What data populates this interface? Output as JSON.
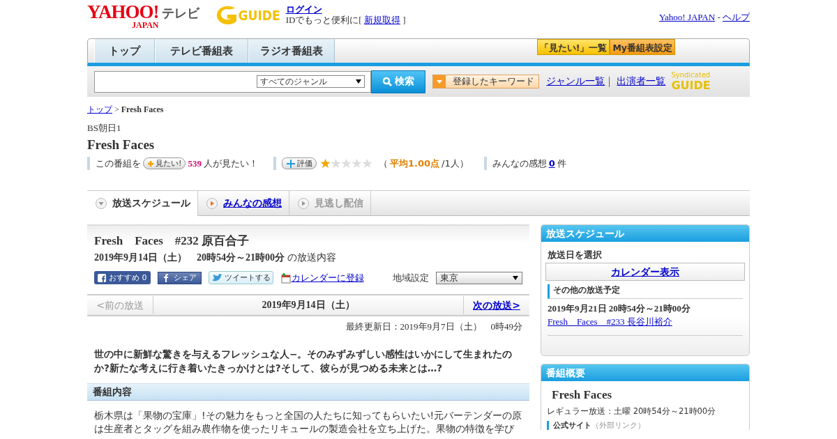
{
  "header": {
    "logo": "YAHOO!",
    "logo_sub": "JAPAN",
    "service": "テレビ",
    "partner_logo": "GUIDE",
    "login_link": "ログイン",
    "login_note": "IDでもっと便利に[",
    "signup_link": "新規取得",
    "note_end": "]",
    "top_links": [
      "Yahoo! JAPAN",
      "ヘルプ"
    ],
    "top_sep": "-"
  },
  "nav": {
    "tabs": [
      "トップ",
      "テレビ番組表",
      "ラジオ番組表"
    ],
    "buttons": [
      "「見たい!」一覧",
      "My番組表設定"
    ]
  },
  "search": {
    "genre": "すべてのジャンル",
    "button": "検索",
    "keyword_button": "登録したキーワード",
    "links": [
      "ジャンル一覧",
      "出演者一覧"
    ],
    "syndicated": "Syndicated",
    "partner_logo": "GUIDE"
  },
  "breadcrumb": {
    "link": "トップ",
    "sep": ">",
    "current": "Fresh Faces"
  },
  "program": {
    "channel": "BS朝日1",
    "title": "Fresh Faces",
    "want_label": "この番組を",
    "want_button": "見たい!",
    "want_count": "539",
    "want_text": "人が見たい！",
    "rate_button": "評価",
    "stars": 1,
    "rating_open": "（",
    "rating_avg": "平均1.00点",
    "rating_count": "/1人）",
    "impressions_label": "みんなの感想",
    "impressions_count": "0",
    "impressions_unit": "件"
  },
  "content_tabs": [
    {
      "label": "放送スケジュール",
      "kind": "current"
    },
    {
      "label": "みんなの感想",
      "kind": "link"
    },
    {
      "label": "見逃し配信",
      "kind": "disabled"
    }
  ],
  "episode": {
    "title": "Fresh　Faces　#232 原百合子",
    "datetime": "2019年9月14日（土）　20時54分～21時00分",
    "suffix": "の放送内容",
    "like_button": "おすすめ",
    "like_count": "0",
    "share_button": "シェア",
    "tweet_button": "ツイートする",
    "calendar_link": "カレンダーに登録",
    "region_label": "地域設定",
    "region": "東京"
  },
  "episode_nav": {
    "prev": "<前の放送",
    "prev_disabled": true,
    "date": "2019年9月14日（土）",
    "next": "次の放送>"
  },
  "updated": "最終更新日：2019年9月7日（土）　0時49分",
  "summary": "世の中に新鮮な驚きを与えるフレッシュな人−。そのみずみずしい感性はいかにして生まれたのか?新たな考えに行き着いたきっかけとは?そして、彼らが見つめる未来とは…?",
  "content_section": {
    "heading": "番組内容",
    "body": "栃木県は「果物の宝庫」!その魅力をもっと全国の人たちに知ってもらいたい!元バーテンダーの原は生産者とタッグを組み農作物を使ったリキュールの製造会社を立ち上げた。果物の特徴を学び"
  },
  "schedule_panel": {
    "header": "放送スケジュール",
    "select_label": "放送日を選択",
    "calendar_button": "カレンダー表示",
    "other_heading": "その他の放送予定",
    "items": [
      {
        "datetime": "2019年9月21日  20時54分～21時00分",
        "link": "Fresh　Faces　#233 長谷川裕介"
      }
    ]
  },
  "overview_panel": {
    "header": "番組概要",
    "title": "Fresh Faces",
    "regular": "レギュラー放送：土曜 20時54分～21時00分",
    "official": "公式サイト",
    "official_note": "（外部リンク）"
  }
}
